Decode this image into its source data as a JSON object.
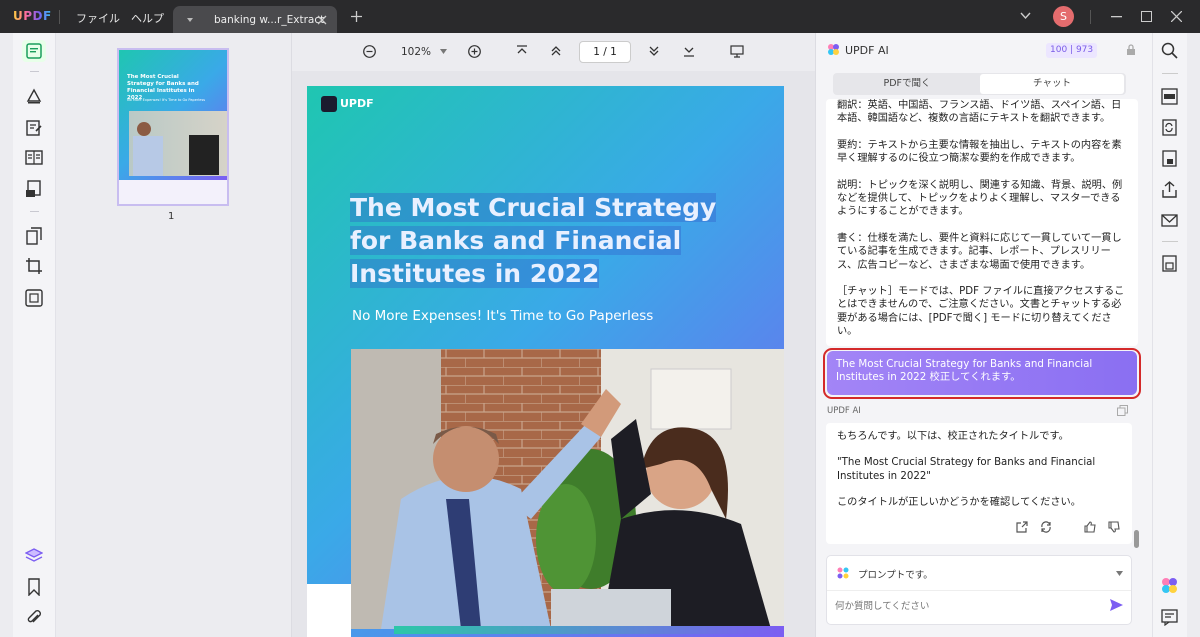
{
  "app": {
    "logo": "UPDF",
    "menu_file": "ファイル",
    "menu_help": "ヘルプ",
    "tab_title": "banking w...r_Extract",
    "avatar_letter": "S",
    "accent": "#7c5ef2"
  },
  "viewer": {
    "zoom": "102%",
    "page_indicator": "1 / 1",
    "thumb_page_number": "1"
  },
  "document": {
    "logo": "UPDF",
    "title_line1": "The Most Crucial Strategy",
    "title_line2": "for Banks and Financial",
    "title_line3": "Institutes in 2022",
    "subtitle": "No More Expenses! It's Time to Go Paperless",
    "thumb_title": "The Most Crucial Strategy for Banks and Financial Institutes in 2022",
    "thumb_sub": "No More Expenses! It's Time to Go Paperless"
  },
  "ai": {
    "header": "UPDF AI",
    "credits_1": "100",
    "credits_2": "973",
    "tab_pdf": "PDFで聞く",
    "tab_chat": "チャット",
    "msg1_p1": "翻訳：英語、中国語、フランス語、ドイツ語、スペイン語、日本語、韓国語など、複数の言語にテキストを翻訳できます。",
    "msg1_p2": "要約：テキストから主要な情報を抽出し、テキストの内容を素早く理解するのに役立つ簡潔な要約を作成できます。",
    "msg1_p3": "説明：トピックを深く説明し、関連する知識、背景、説明、例などを提供して、トピックをよりよく理解し、マスターできるようにすることができます。",
    "msg1_p4": "書く：仕様を満たし、要件と資料に応じて一貫していて一貫している記事を生成できます。記事、レポート、プレスリリース、広告コピーなど、さまざまな場面で使用できます。",
    "msg1_p5": "［チャット］モードでは、PDF ファイルに直接アクセスすることはできませんので、ご注意ください。文書とチャットする必要がある場合には、[PDFで聞く] モードに切り替えてください。",
    "user_msg": "The Most Crucial Strategy for Banks and Financial Institutes in 2022 校正してくれます。",
    "ai_label": "UPDF AI",
    "reply_p1": "もちろんです。以下は、校正されたタイトルです。",
    "reply_p2": "\"The Most Crucial Strategy for Banks and Financial Institutes in 2022\"",
    "reply_p3": "このタイトルが正しいかどうかを確認してください。",
    "prompt_label": "プロンプトです。",
    "input_placeholder": "何か質問してください"
  }
}
